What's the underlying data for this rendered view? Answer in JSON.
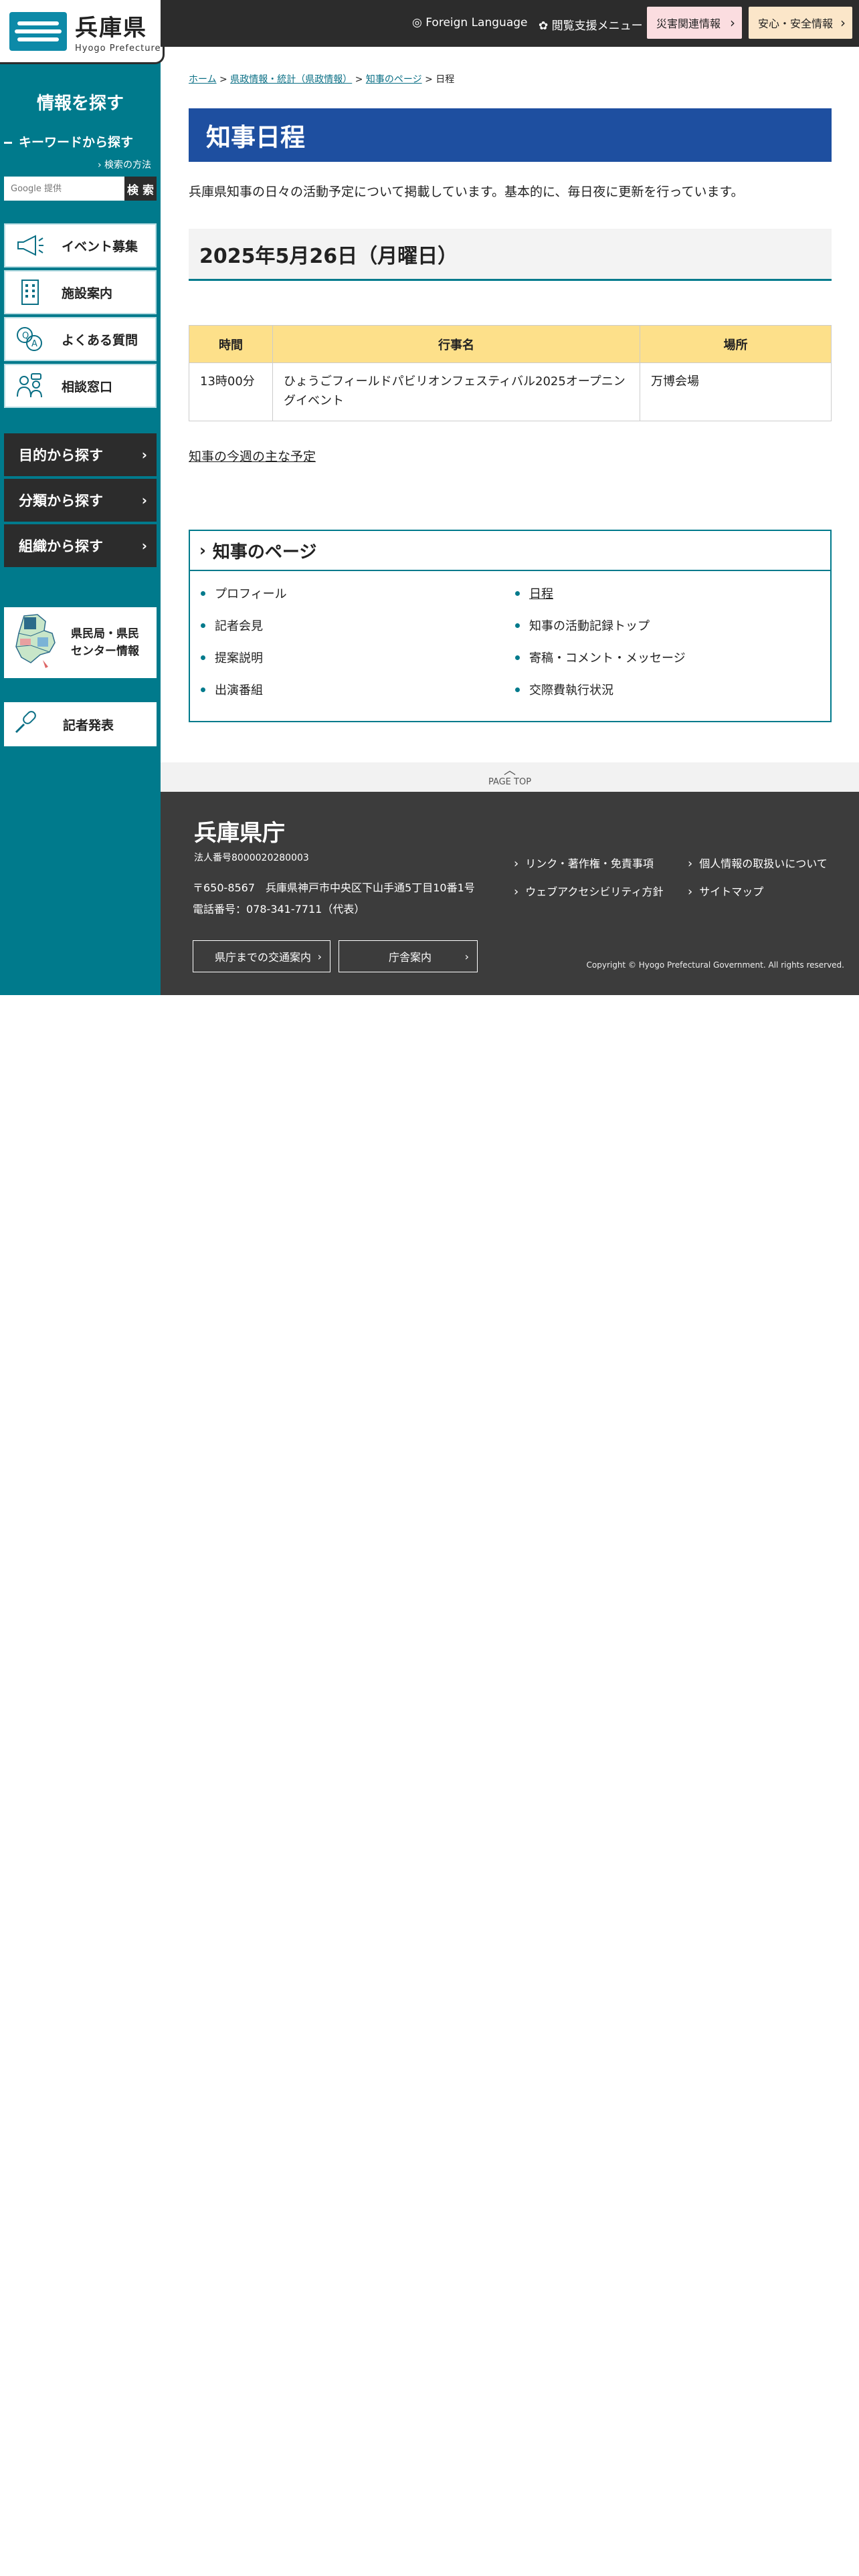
{
  "header": {
    "logo_jp": "兵庫県",
    "logo_en": "Hyogo Prefecture",
    "foreign_language": "Foreign Language",
    "access_menu": "閲覧支援メニュー",
    "disaster_info": "災害関連情報",
    "safety_info": "安心・安全情報"
  },
  "sidebar": {
    "title": "情報を探す",
    "keyword_title": "キーワードから探す",
    "search_method": "検索の方法",
    "search_placeholder": "Google 提供",
    "search_button": "検 索",
    "quick_items": [
      {
        "label": "イベント募集",
        "icon": "megaphone-icon"
      },
      {
        "label": "施設案内",
        "icon": "building-icon"
      },
      {
        "label": "よくある質問",
        "icon": "qa-icon"
      },
      {
        "label": "相談窓口",
        "icon": "consultation-icon"
      }
    ],
    "find_items": [
      {
        "label": "目的から探す"
      },
      {
        "label": "分類から探す"
      },
      {
        "label": "組織から探す"
      }
    ],
    "center_label_line1": "県民局・県民",
    "center_label_line2": "センター情報",
    "press_label": "記者発表"
  },
  "breadcrumb": {
    "items": [
      "ホーム",
      "県政情報・統計（県政情報）",
      "知事のページ"
    ],
    "current": "日程",
    "separator": ">"
  },
  "main": {
    "title": "知事日程",
    "intro": "兵庫県知事の日々の活動予定について掲載しています。基本的に、毎日夜に更新を行っています。",
    "date_heading": "2025年5月26日（月曜日）",
    "table": {
      "headers": [
        "時間",
        "行事名",
        "場所"
      ],
      "rows": [
        {
          "time": "13時00分",
          "event_line1": "ひょうごフィールドパビリオンフェスティバル2025オープニン",
          "event_line2": "グイベント",
          "place": "万博会場"
        }
      ]
    },
    "weekly_link": "知事の今週の主な予定",
    "governor_box": {
      "title": "知事のページ",
      "items": [
        {
          "label": "プロフィール"
        },
        {
          "label": "日程"
        },
        {
          "label": "記者会見"
        },
        {
          "label": "知事の活動記録トップ"
        },
        {
          "label": "提案説明"
        },
        {
          "label": "寄稿・コメント・メッセージ"
        },
        {
          "label": "出演番組"
        },
        {
          "label": "交際費執行状況"
        }
      ]
    }
  },
  "page_top": "PAGE TOP",
  "footer": {
    "name": "兵庫県庁",
    "corp_no": "法人番号8000020280003",
    "address": "〒650-8567　兵庫県神戸市中央区下山手通5丁目10番1号",
    "tel": "電話番号：078-341-7711（代表）",
    "access_button": "県庁までの交通案内",
    "office_button": "庁舎案内",
    "links": [
      "リンク・著作権・免責事項",
      "個人情報の取扱いについて",
      "ウェブアクセシビリティ方針",
      "サイトマップ"
    ],
    "copyright": "Copyright © Hyogo Prefectural Government. All rights reserved."
  },
  "colors": {
    "teal": "#007a8c",
    "navy_title": "#1e4fa0",
    "dark": "#2c2c2c",
    "table_header": "#fde08a",
    "disaster_bg": "#fbdde0",
    "safety_bg": "#fbe6c9"
  }
}
